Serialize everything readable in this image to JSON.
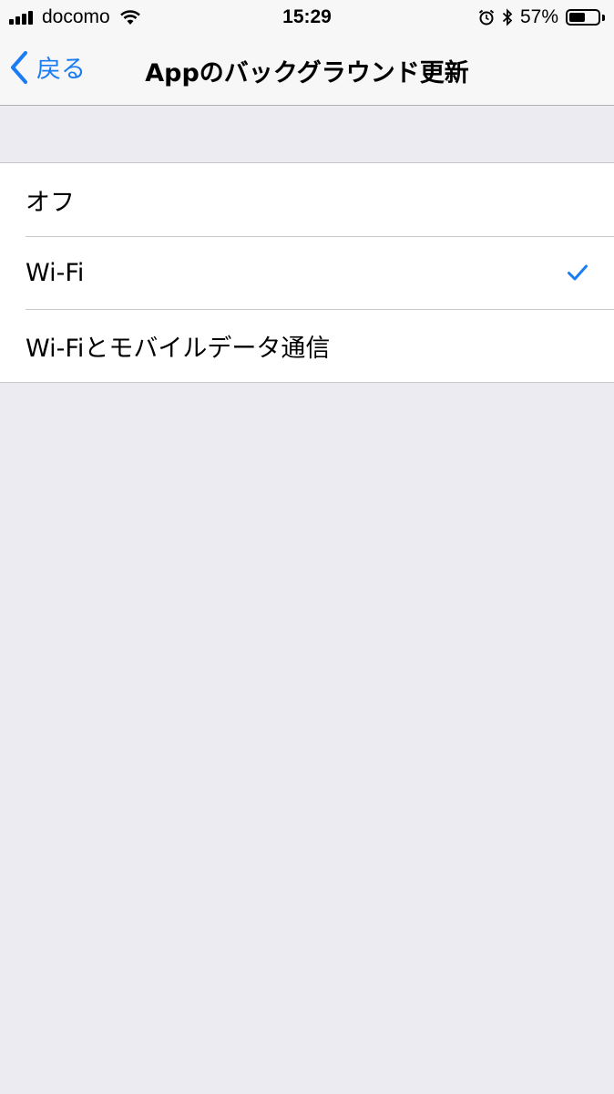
{
  "status_bar": {
    "carrier": "docomo",
    "time": "15:29",
    "battery_percent": "57%",
    "battery_level": 0.57
  },
  "nav": {
    "back_label": "戻る",
    "title": "Appのバックグラウンド更新"
  },
  "options": [
    {
      "label": "オフ",
      "selected": false
    },
    {
      "label": "Wi-Fi",
      "selected": true
    },
    {
      "label": "Wi-Fiとモバイルデータ通信",
      "selected": false
    }
  ],
  "colors": {
    "accent": "#1a7cf5",
    "background": "#ebebf1",
    "separator": "#c8c7cc"
  },
  "icons": [
    "signal-icon",
    "wifi-icon",
    "alarm-icon",
    "bluetooth-icon",
    "battery-icon",
    "chevron-left-icon",
    "checkmark-icon"
  ]
}
